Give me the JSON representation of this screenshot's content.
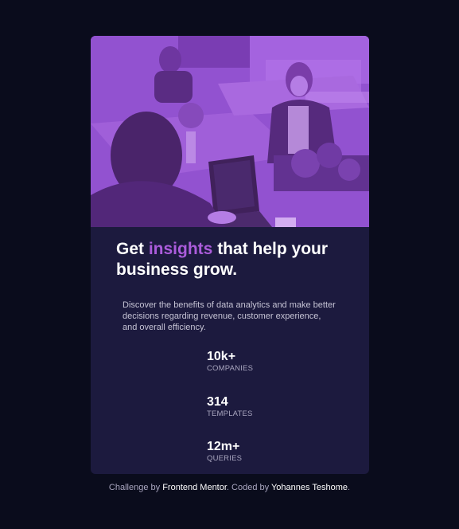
{
  "card": {
    "heading_before": "Get ",
    "heading_accent": "insights",
    "heading_after": " that help your business grow.",
    "description": "Discover the benefits of data analytics and make better decisions regarding revenue, customer experience, and overall efficiency.",
    "stats": [
      {
        "value": "10k+",
        "label": "COMPANIES"
      },
      {
        "value": "314",
        "label": "TEMPLATES"
      },
      {
        "value": "12m+",
        "label": "QUERIES"
      }
    ]
  },
  "attribution": {
    "prefix": "Challenge by ",
    "challenge_link": "Frontend Mentor",
    "middle": ". Coded by ",
    "author_link": "Yohannes Teshome",
    "suffix": "."
  },
  "colors": {
    "page_bg": "#0a0c1c",
    "card_bg": "#1c1a3e",
    "accent": "#ab5cdb",
    "image_overlay": "#7a3fb8"
  }
}
